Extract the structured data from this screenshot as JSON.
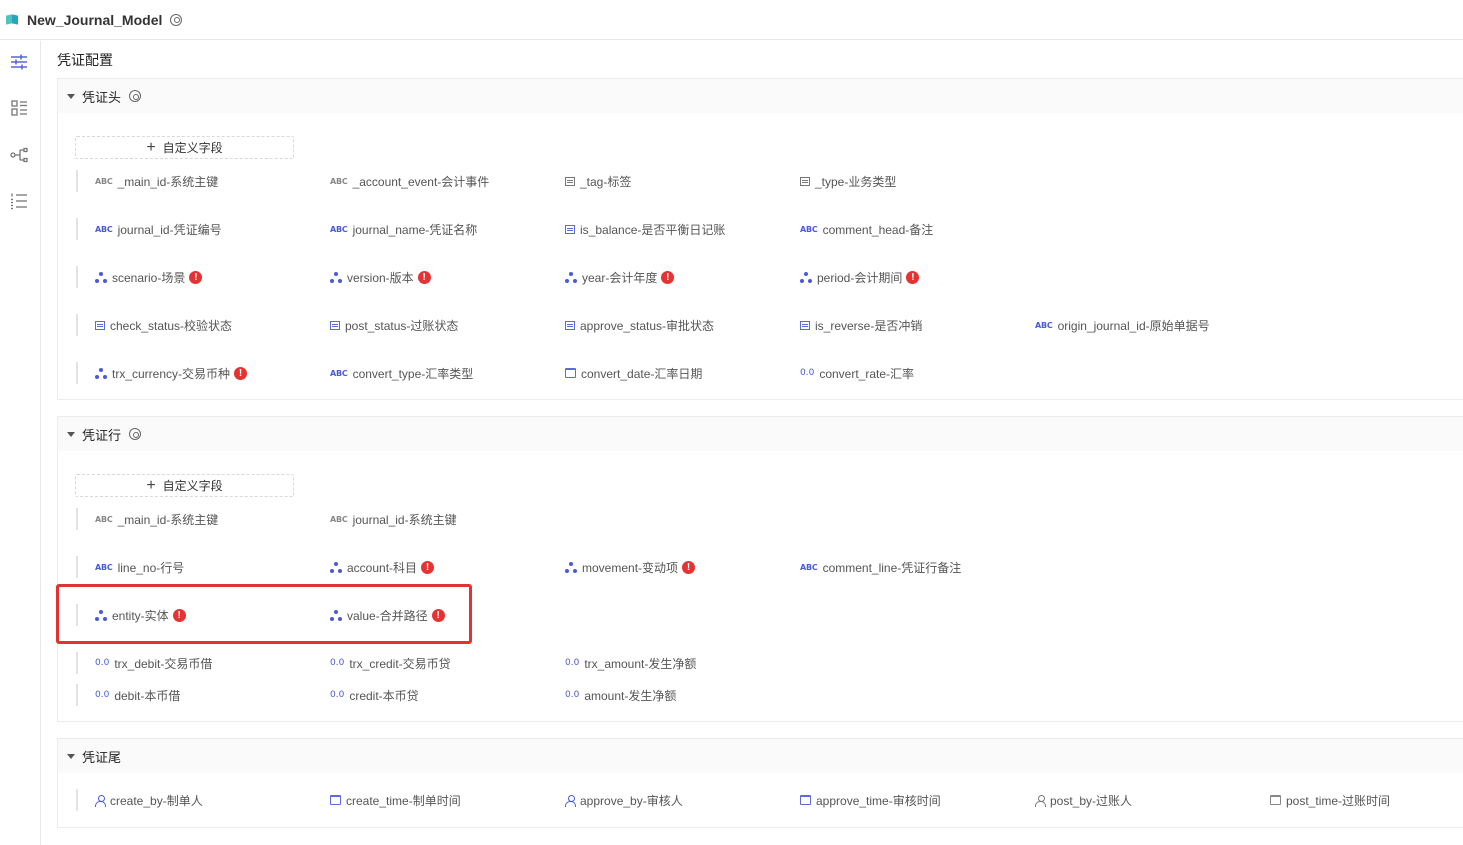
{
  "topbar": {
    "title": "New_Journal_Model",
    "settings_icon": "gear-icon",
    "model_icon": "book-icon"
  },
  "sidebar": {
    "items": [
      {
        "icon": "sliders-icon"
      },
      {
        "icon": "layout-list-icon"
      },
      {
        "icon": "branch-icon"
      },
      {
        "icon": "ordered-list-icon"
      }
    ]
  },
  "page_title": "凭证配置",
  "add_field_label": "自定义字段",
  "colors": {
    "accent": "#4a5bd6",
    "required": "#e53333",
    "highlight": "#e23232"
  },
  "header_section": {
    "title": "凭证头",
    "rows": [
      [
        {
          "type": "abc-grey",
          "label": "_main_id-系统主键"
        },
        {
          "type": "abc-grey",
          "label": "_account_event-会计事件"
        },
        {
          "type": "box-grey",
          "label": "_tag-标签"
        },
        {
          "type": "box-grey",
          "label": "_type-业务类型"
        }
      ],
      [
        {
          "type": "abc",
          "label": "journal_id-凭证编号"
        },
        {
          "type": "abc",
          "label": "journal_name-凭证名称"
        },
        {
          "type": "box",
          "label": "is_balance-是否平衡日记账"
        },
        {
          "type": "abc",
          "label": "comment_head-备注"
        }
      ],
      [
        {
          "type": "dim",
          "label": "scenario-场景",
          "required": true
        },
        {
          "type": "dim",
          "label": "version-版本",
          "required": true
        },
        {
          "type": "dim",
          "label": "year-会计年度",
          "required": true
        },
        {
          "type": "dim",
          "label": "period-会计期间",
          "required": true
        }
      ],
      [
        {
          "type": "box",
          "label": "check_status-校验状态"
        },
        {
          "type": "box",
          "label": "post_status-过账状态"
        },
        {
          "type": "box",
          "label": "approve_status-审批状态"
        },
        {
          "type": "box",
          "label": "is_reverse-是否冲销"
        },
        {
          "type": "abc",
          "label": "origin_journal_id-原始单据号"
        }
      ],
      [
        {
          "type": "dim",
          "label": "trx_currency-交易币种",
          "required": true
        },
        {
          "type": "abc",
          "label": "convert_type-汇率类型"
        },
        {
          "type": "cal",
          "label": "convert_date-汇率日期"
        },
        {
          "type": "num",
          "label": "convert_rate-汇率"
        }
      ]
    ]
  },
  "line_section": {
    "title": "凭证行",
    "rows": [
      [
        {
          "type": "abc-grey",
          "label": "_main_id-系统主键"
        },
        {
          "type": "abc-grey",
          "label": "journal_id-系统主键"
        }
      ],
      [
        {
          "type": "abc",
          "label": "line_no-行号"
        },
        {
          "type": "dim",
          "label": "account-科目",
          "required": true
        },
        {
          "type": "dim",
          "label": "movement-变动项",
          "required": true
        },
        {
          "type": "abc",
          "label": "comment_line-凭证行备注"
        }
      ],
      [
        {
          "type": "dim",
          "label": "entity-实体",
          "required": true
        },
        {
          "type": "dim",
          "label": "value-合并路径",
          "required": true
        }
      ],
      [
        {
          "type": "num",
          "label": "trx_debit-交易币借"
        },
        {
          "type": "num",
          "label": "trx_credit-交易币贷"
        },
        {
          "type": "num",
          "label": "trx_amount-发生净额"
        }
      ],
      [
        {
          "type": "num",
          "label": "debit-本币借"
        },
        {
          "type": "num",
          "label": "credit-本币贷"
        },
        {
          "type": "num",
          "label": "amount-发生净额"
        }
      ]
    ]
  },
  "tail_section": {
    "title": "凭证尾",
    "rows": [
      [
        {
          "type": "person",
          "label": "create_by-制单人"
        },
        {
          "type": "cal",
          "label": "create_time-制单时间"
        },
        {
          "type": "person",
          "label": "approve_by-审核人"
        },
        {
          "type": "cal",
          "label": "approve_time-审核时间"
        },
        {
          "type": "person-grey",
          "label": "post_by-过账人"
        },
        {
          "type": "cal-grey",
          "label": "post_time-过账时间"
        }
      ]
    ]
  }
}
